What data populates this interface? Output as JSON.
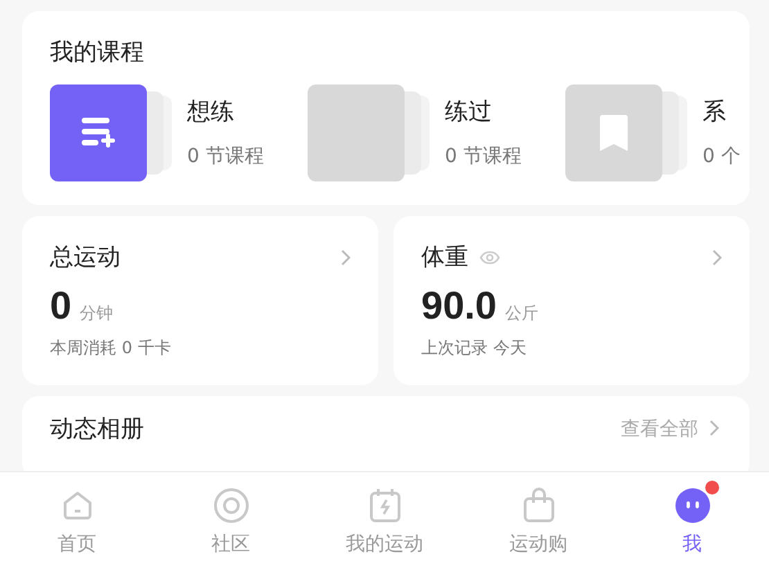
{
  "courses": {
    "title": "我的课程",
    "items": [
      {
        "kind": "want",
        "title": "想练",
        "count": "0 节课程"
      },
      {
        "kind": "done",
        "title": "练过",
        "count": "0 节课程"
      },
      {
        "kind": "series",
        "title": "系",
        "count": "0 个"
      }
    ]
  },
  "stats": [
    {
      "title": "总运动",
      "value": "0",
      "unit": "分钟",
      "note": "本周消耗 0 千卡",
      "eye": false
    },
    {
      "title": "体重",
      "value": "90.0",
      "unit": "公斤",
      "note": "上次记录 今天",
      "eye": true
    }
  ],
  "album": {
    "title": "动态相册",
    "link": "查看全部"
  },
  "tabs": [
    {
      "kind": "home",
      "label": "首页",
      "selected": false,
      "badge": false
    },
    {
      "kind": "community",
      "label": "社区",
      "selected": false,
      "badge": false
    },
    {
      "kind": "sport",
      "label": "我的运动",
      "selected": false,
      "badge": false
    },
    {
      "kind": "shop",
      "label": "运动购",
      "selected": false,
      "badge": false
    },
    {
      "kind": "me",
      "label": "我",
      "selected": true,
      "badge": true
    }
  ]
}
